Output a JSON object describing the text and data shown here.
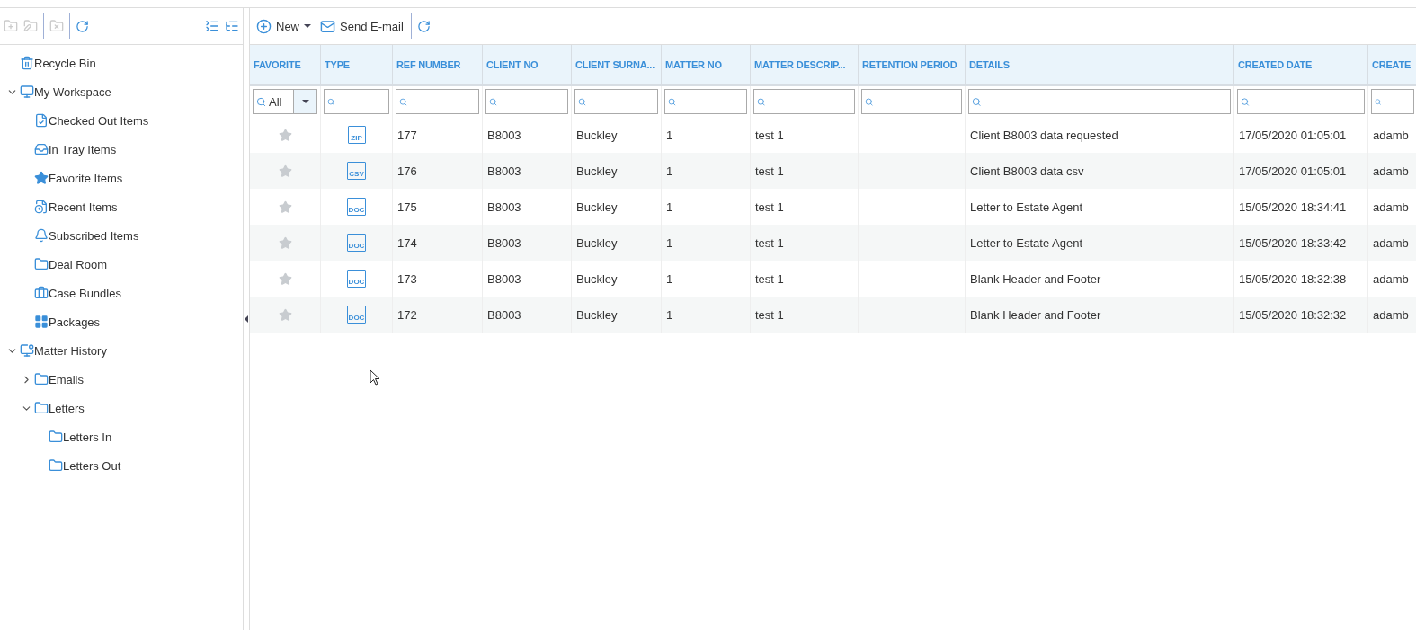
{
  "sidebar": {
    "tree": [
      {
        "label": "Recycle Bin"
      },
      {
        "label": "My Workspace",
        "expanded": true,
        "children": [
          {
            "label": "Checked Out Items"
          },
          {
            "label": "In Tray Items"
          },
          {
            "label": "Favorite Items"
          },
          {
            "label": "Recent Items"
          },
          {
            "label": "Subscribed Items"
          },
          {
            "label": "Deal Room"
          },
          {
            "label": "Case Bundles"
          },
          {
            "label": "Packages"
          }
        ]
      },
      {
        "label": "Matter History",
        "expanded": true,
        "children": [
          {
            "label": "Emails",
            "expanded": false
          },
          {
            "label": "Letters",
            "expanded": true,
            "children": [
              {
                "label": "Letters In"
              },
              {
                "label": "Letters Out"
              }
            ]
          }
        ]
      }
    ]
  },
  "toolbar": {
    "new_label": "New",
    "email_label": "Send E-mail"
  },
  "table": {
    "columns": [
      "FAVORITE",
      "TYPE",
      "REF NUMBER",
      "CLIENT NO",
      "CLIENT SURNA...",
      "MATTER NO",
      "MATTER DESCRIP...",
      "RETENTION PERIOD",
      "DETAILS",
      "CREATED DATE",
      "CREATE"
    ],
    "favorite_filter": "All",
    "rows": [
      {
        "favorite": false,
        "type": "ZIP",
        "ref": "177",
        "client_no": "B8003",
        "surname": "Buckley",
        "matter_no": "1",
        "matter_desc": "test 1",
        "details": "Client B8003 data requested",
        "created": "17/05/2020 01:05:01",
        "created_by": "adamb"
      },
      {
        "favorite": false,
        "type": "CSV",
        "ref": "176",
        "client_no": "B8003",
        "surname": "Buckley",
        "matter_no": "1",
        "matter_desc": "test 1",
        "details": "Client B8003 data csv",
        "created": "17/05/2020 01:05:01",
        "created_by": "adamb"
      },
      {
        "favorite": false,
        "type": "DOC",
        "ref": "175",
        "client_no": "B8003",
        "surname": "Buckley",
        "matter_no": "1",
        "matter_desc": "test 1",
        "details": "Letter to Estate Agent",
        "created": "15/05/2020 18:34:41",
        "created_by": "adamb"
      },
      {
        "favorite": false,
        "type": "DOC",
        "ref": "174",
        "client_no": "B8003",
        "surname": "Buckley",
        "matter_no": "1",
        "matter_desc": "test 1",
        "details": "Letter to Estate Agent",
        "created": "15/05/2020 18:33:42",
        "created_by": "adamb"
      },
      {
        "favorite": false,
        "type": "DOC",
        "ref": "173",
        "client_no": "B8003",
        "surname": "Buckley",
        "matter_no": "1",
        "matter_desc": "test 1",
        "details": "Blank Header and Footer",
        "created": "15/05/2020 18:32:38",
        "created_by": "adamb"
      },
      {
        "favorite": false,
        "type": "DOC",
        "ref": "172",
        "client_no": "B8003",
        "surname": "Buckley",
        "matter_no": "1",
        "matter_desc": "test 1",
        "details": "Blank Header and Footer",
        "created": "15/05/2020 18:32:32",
        "created_by": "adamb"
      }
    ]
  }
}
